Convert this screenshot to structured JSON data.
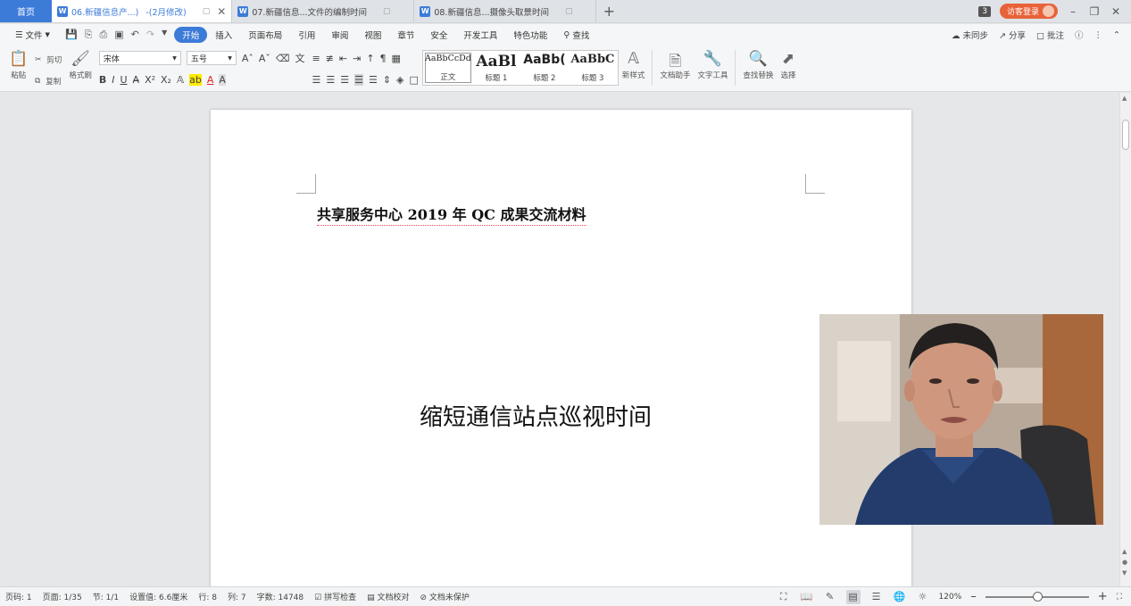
{
  "tabs": {
    "home_label": "首页",
    "doc1": {
      "title": "06.新疆信息产...)",
      "status": "-(2月修改)"
    },
    "doc2": {
      "title": "07.新疆信息...文件的编制时间"
    },
    "doc3": {
      "title": "08.新疆信息...摄像头取景时间"
    },
    "add": "+",
    "window_count": "3",
    "login_label": "访客登录"
  },
  "menu": {
    "file": "文件",
    "items": [
      "开始",
      "插入",
      "页面布局",
      "引用",
      "审阅",
      "视图",
      "章节",
      "安全",
      "开发工具",
      "特色功能"
    ],
    "search": "查找",
    "sync": "未同步",
    "share": "分享",
    "comment": "批注"
  },
  "ribbon": {
    "paste": "粘贴",
    "cut": "剪切",
    "copy": "复制",
    "format_painter": "格式刷",
    "font_name": "宋体",
    "font_size": "五号",
    "styles": [
      {
        "preview": "AaBbCcDd",
        "label": "正文"
      },
      {
        "preview": "AaBl",
        "label": "标题 1"
      },
      {
        "preview": "AaBb(",
        "label": "标题 2"
      },
      {
        "preview": "AaBbC",
        "label": "标题 3"
      }
    ],
    "new_style": "新样式",
    "doc_assistant": "文档助手",
    "text_tools": "文字工具",
    "find_replace": "查找替换",
    "select": "选择"
  },
  "document": {
    "heading": "共享服务中心 2019 年 QC 成果交流材料",
    "title": "缩短通信站点巡视时间"
  },
  "status": {
    "page_code": "页码: 1",
    "page": "页面: 1/35",
    "section": "节: 1/1",
    "position": "设置值: 6.6厘米",
    "line": "行: 8",
    "column": "列: 7",
    "word_count": "字数: 14748",
    "spell_check": "拼写检查",
    "proofread": "文档校对",
    "protection": "文档未保护",
    "zoom": "120%",
    "zoom_fraction": 0.5
  }
}
